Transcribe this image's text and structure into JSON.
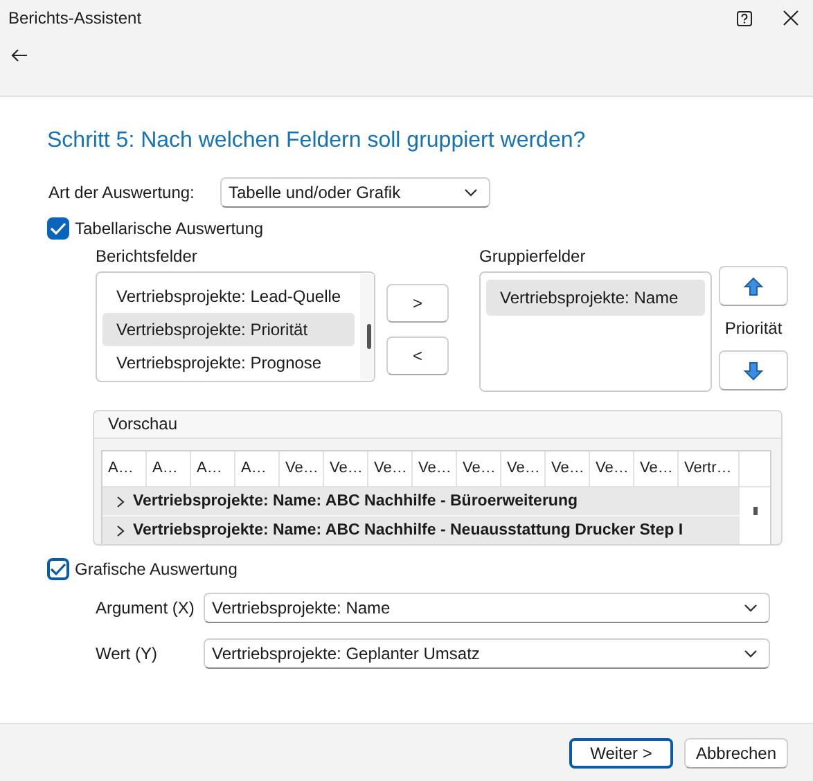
{
  "window": {
    "title": "Berichts-Assistent"
  },
  "heading": "Schritt 5: Nach welchen Feldern soll gruppiert werden?",
  "evaluation_type": {
    "label": "Art der Auswertung:",
    "value": "Tabelle und/oder Grafik"
  },
  "tabular": {
    "label": "Tabellarische Auswertung",
    "checked": true,
    "report_fields": {
      "label": "Berichtsfelder",
      "items": [
        {
          "label": "Vertriebsprojekte: Lead-Quelle",
          "selected": false
        },
        {
          "label": "Vertriebsprojekte: Priorität",
          "selected": true
        },
        {
          "label": "Vertriebsprojekte: Prognose",
          "selected": false
        }
      ]
    },
    "add_button": ">",
    "remove_button": "<",
    "group_fields": {
      "label": "Gruppierfelder",
      "items": [
        {
          "label": "Vertriebsprojekte: Name",
          "selected": true
        }
      ]
    },
    "priority_label": "Priorität"
  },
  "preview": {
    "title": "Vorschau",
    "columns": [
      "A…",
      "A…",
      "A…",
      "A…",
      "Ve…",
      "Ve…",
      "Ve…",
      "Ve…",
      "Ve…",
      "Ve…",
      "Ve…",
      "Ve…",
      "Ve…",
      "Vertr…"
    ],
    "groups": [
      {
        "label": "Vertriebsprojekte: Name: ABC Nachhilfe - Büroerweiterung",
        "expanded": false
      },
      {
        "label": "Vertriebsprojekte: Name: ABC Nachhilfe - Neuausstattung Drucker Step I",
        "expanded": false
      }
    ]
  },
  "graphic": {
    "label": "Grafische Auswertung",
    "checked": true,
    "fields": [
      {
        "label": "Argument (X)",
        "value": "Vertriebsprojekte: Name"
      },
      {
        "label": "Wert (Y)",
        "value": "Vertriebsprojekte: Geplanter Umsatz"
      }
    ]
  },
  "buttons": [
    {
      "label": "Weiter >",
      "default": true
    },
    {
      "label": "Abbrechen",
      "default": false
    }
  ]
}
